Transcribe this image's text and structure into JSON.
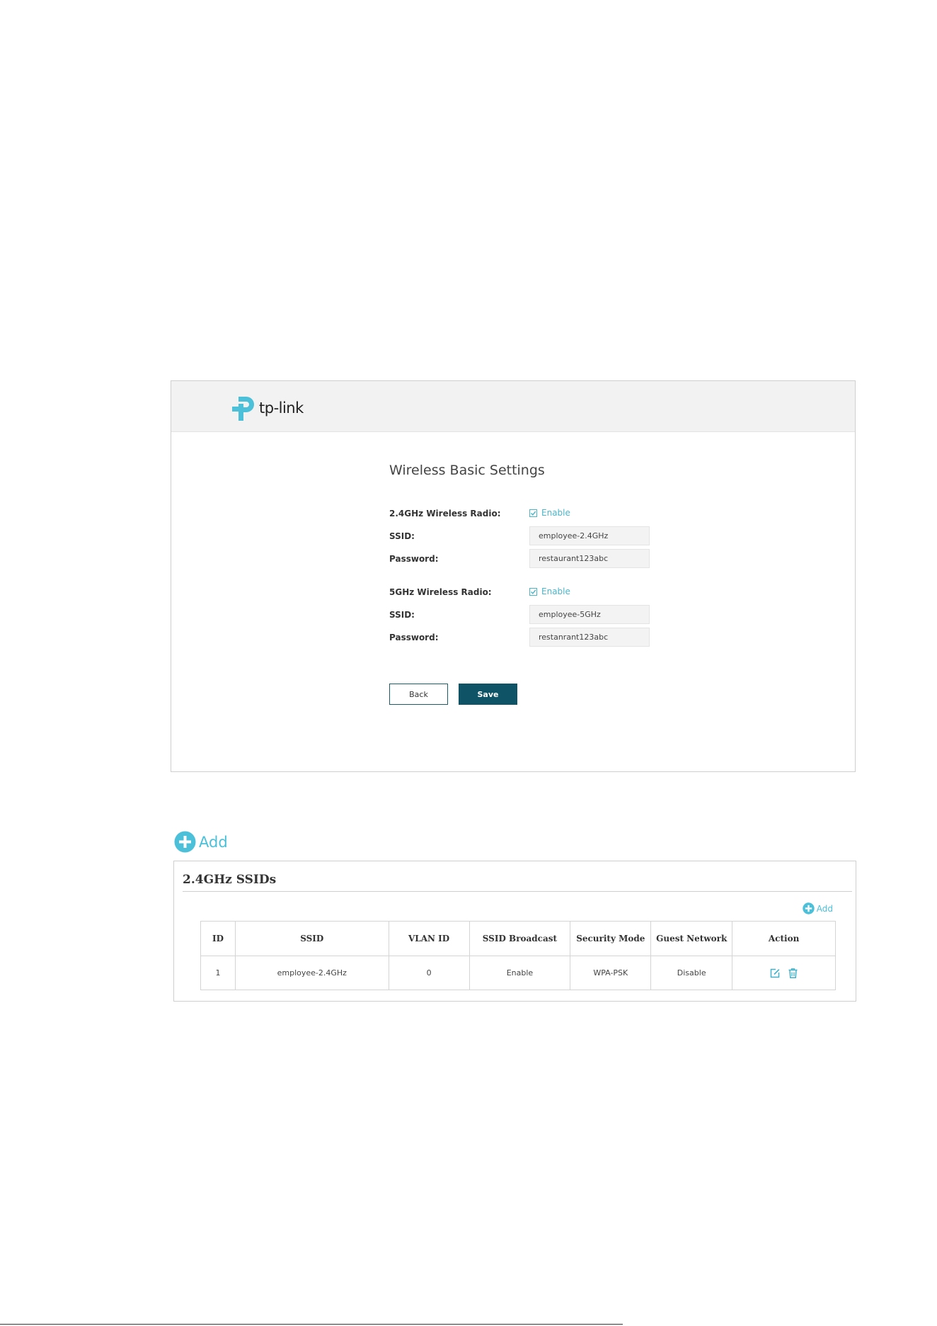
{
  "brand": {
    "name": "tp-link",
    "accent_color": "#4bc0d8",
    "primary_button_color": "#0e5466"
  },
  "wizard": {
    "title": "Wireless Basic Settings",
    "radio_24": {
      "label": "2.4GHz Wireless Radio:",
      "checkbox_label": "Enable",
      "checked": true,
      "ssid_label": "SSID:",
      "ssid_value": "employee-2.4GHz",
      "password_label": "Password:",
      "password_value": "restaurant123abc"
    },
    "radio_5": {
      "label": "5GHz Wireless Radio:",
      "checkbox_label": "Enable",
      "checked": true,
      "ssid_label": "SSID:",
      "ssid_value": "employee-5GHz",
      "password_label": "Password:",
      "password_value": "restanrant123abc"
    },
    "back_label": "Back",
    "save_label": "Save"
  },
  "ssid_list": {
    "add_label": "Add",
    "panel_title": "2.4GHz SSIDs",
    "table_add_label": "Add",
    "columns": [
      "ID",
      "SSID",
      "VLAN ID",
      "SSID Broadcast",
      "Security Mode",
      "Guest Network",
      "Action"
    ],
    "rows": [
      {
        "id": "1",
        "ssid": "employee-2.4GHz",
        "vlan_id": "0",
        "broadcast": "Enable",
        "security": "WPA-PSK",
        "guest": "Disable",
        "actions": [
          "edit-icon",
          "trash-icon"
        ]
      }
    ]
  }
}
